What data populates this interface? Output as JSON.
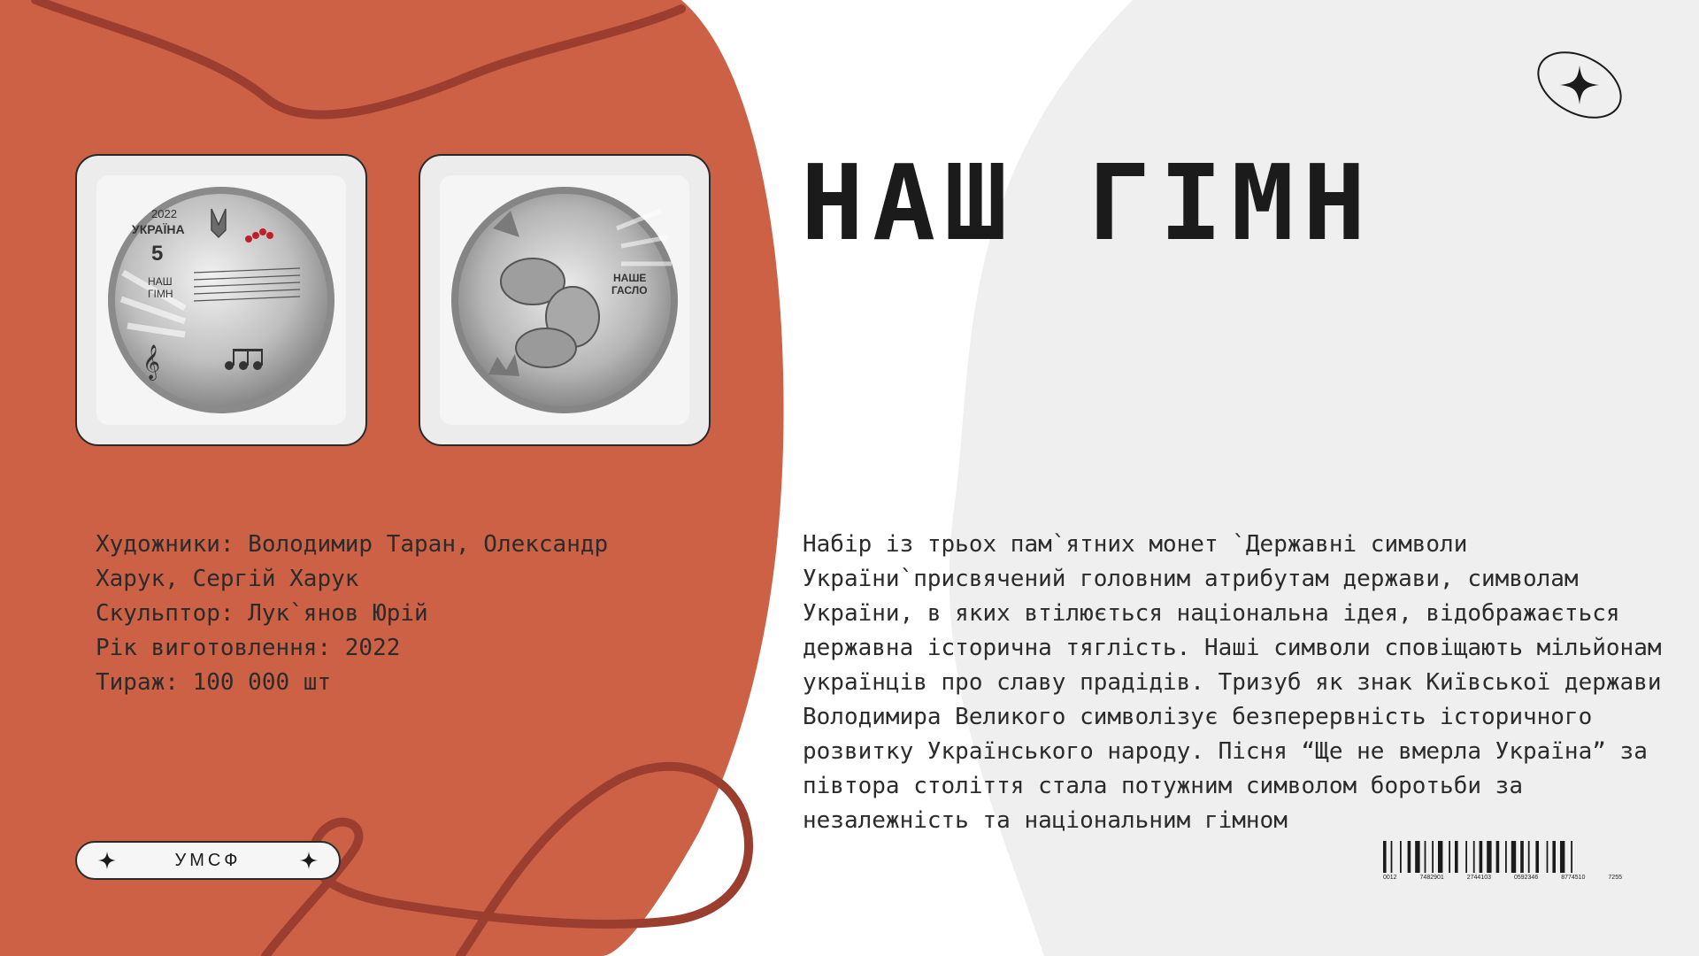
{
  "title": "НАШ ГІМН",
  "colors": {
    "accent_blob": "#cd6146",
    "squiggle": "#9b3e2f",
    "light_blob": "#efefef",
    "text": "#2b2b2b"
  },
  "coins": {
    "obverse": {
      "year": "2022",
      "country": "УКРАЇНА",
      "denomination": "5",
      "name_line1": "НАШ",
      "name_line2": "ГІМН"
    },
    "reverse": {
      "motto_line1": "НАШЕ",
      "motto_line2": "ГАСЛО"
    }
  },
  "credits": [
    "Художники: Володимир Таран, Олександр",
    "Харук, Сергій Харук",
    "Скульптор: Лук`янов Юрій",
    "Рік виготовлення: 2022",
    "Тираж: 100 000 шт"
  ],
  "description": "Набір із трьох пам`ятних монет `Державні символи\nУкраїни`присвячений головним атрибутам держави, символам\nУкраїни, в яких втілюється національна ідея, відображається\nдержавна історична тяглість. Наші символи сповіщають мільйонам\nукраїнців про славу прадідів. Тризуб як знак Київської держави\nВолодимира Великого символізує безперервність історичного\nрозвитку Українського народу. Пісня “Ще не вмерла Україна” за\nпівтора століття стала потужним символом боротьби за\nнезалежність та національним гімном",
  "pill": {
    "label": "УМСФ"
  },
  "icons": {
    "pill_left": "sparkle-icon",
    "pill_right": "sparkle-icon",
    "badge": "sparkle-icon"
  },
  "barcode": {
    "numbers": [
      "0012",
      "7482901",
      "2744103",
      "0592346",
      "8774510",
      "7255"
    ]
  }
}
